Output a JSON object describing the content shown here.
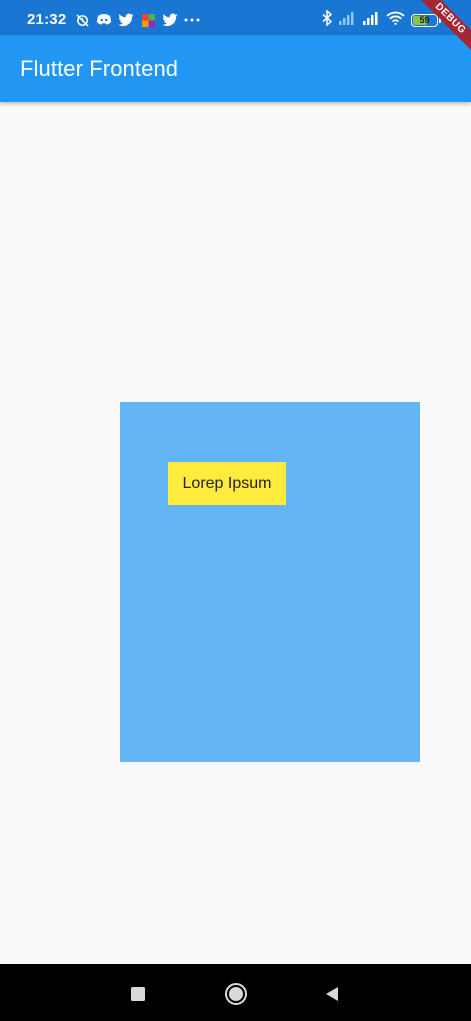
{
  "status_bar": {
    "time": "21:32",
    "battery_level": "59",
    "battery_fraction": 0.59,
    "left_icons": [
      "alarm-off-icon",
      "discord-icon",
      "twitter-icon",
      "app-icon",
      "twitter-icon",
      "more-dots-icon"
    ],
    "right_icons": [
      "bluetooth-icon",
      "signal-weak-icon",
      "signal-icon",
      "wifi-icon",
      "battery-icon"
    ]
  },
  "app_bar": {
    "title": "Flutter Frontend",
    "color": "#2196f3"
  },
  "debug_banner": {
    "label": "DEBUG"
  },
  "content": {
    "blue_box_color": "#64b5f6",
    "yellow_box_color": "#ffeb3b",
    "label_text": "Lorep Ipsum"
  },
  "nav_bar": {
    "buttons": [
      "recents-button",
      "home-button",
      "back-button"
    ]
  }
}
